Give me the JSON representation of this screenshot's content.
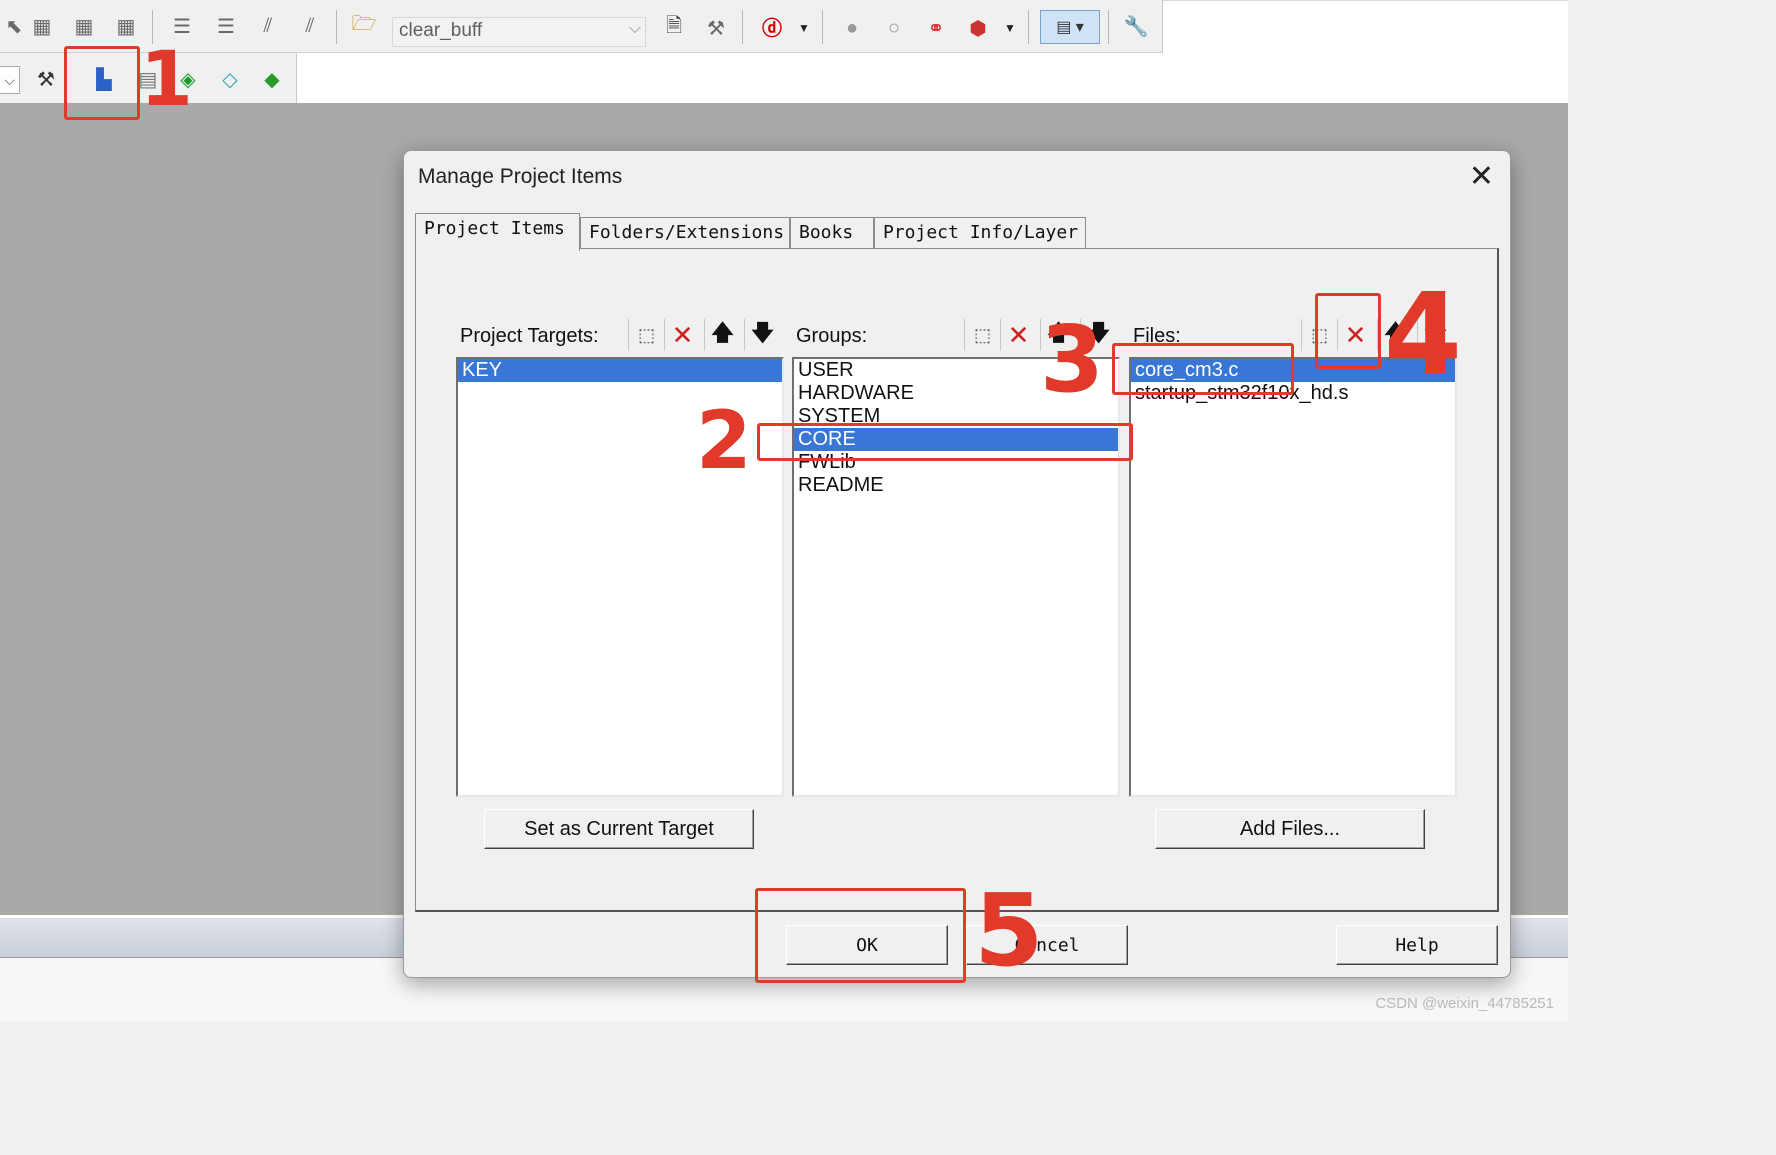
{
  "toolbar": {
    "combo_value": "clear_buff",
    "icons": [
      "back-icon",
      "book-icon",
      "book2-icon",
      "book3-icon",
      "indent-icon",
      "outdent-icon",
      "comment-icon",
      "uncomment-icon",
      "open-folder-icon",
      "find-file-icon",
      "find-replace-icon",
      "debug-icon",
      "breakpoint-icon",
      "breakpoint-empty-icon",
      "breakpoint-disable-icon",
      "breakpoint-clear-icon",
      "window-icon",
      "wrench-icon"
    ],
    "row2_icons": [
      "target-options-icon",
      "manage-project-icon",
      "file-ext-icon",
      "pack-installer-icon",
      "select-device-icon",
      "manage-runtime-icon"
    ]
  },
  "dialog": {
    "title": "Manage Project Items",
    "close_glyph": "✕",
    "tabs": [
      "Project Items",
      "Folders/Extensions",
      "Books",
      "Project Info/Layer"
    ],
    "targets_label": "Project Targets:",
    "groups_label": "Groups:",
    "files_label": "Files:",
    "targets": [
      "KEY"
    ],
    "groups": [
      "USER",
      "HARDWARE",
      "SYSTEM",
      "CORE",
      "FWLib",
      "README"
    ],
    "selected_group": "CORE",
    "files": [
      "core_cm3.c",
      "startup_stm32f10x_hd.s"
    ],
    "selected_file": "core_cm3.c",
    "set_target_button": "Set as Current Target",
    "add_files_button": "Add Files...",
    "ok_button": "OK",
    "cancel_button": "Cancel",
    "help_button": "Help"
  },
  "annotations": [
    "1",
    "2",
    "3",
    "4",
    "5"
  ],
  "watermark": "CSDN @weixin_44785251",
  "colors": {
    "selection": "#3a76d6",
    "annotation": "#e23a2a",
    "workspace": "#a9a9a9"
  }
}
